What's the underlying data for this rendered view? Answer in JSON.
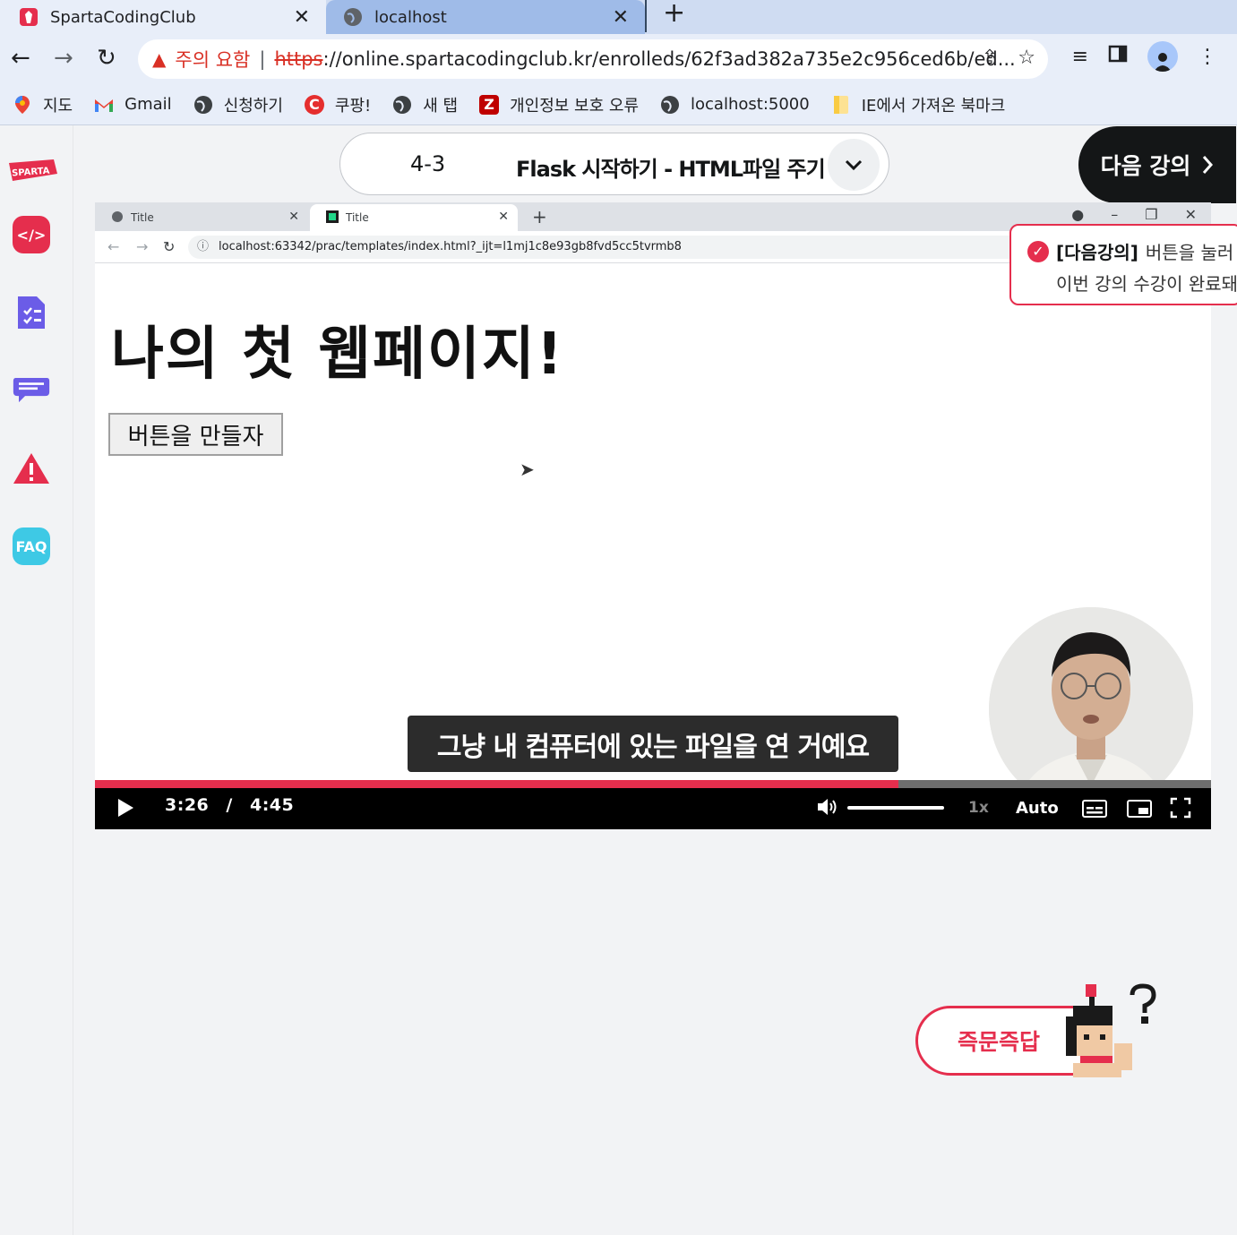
{
  "browser": {
    "tabs": [
      {
        "title": "SpartaCodingClub",
        "active": true
      },
      {
        "title": "localhost",
        "active": false
      }
    ],
    "omnibox": {
      "warning": "주의 요함",
      "scheme": "https",
      "url_rest": "://online.spartacodingclub.kr/enrolleds/62f3ad382a735e2c956ced6b/ed..."
    },
    "bookmarks": [
      {
        "label": "지도",
        "icon": "maps-pin-icon"
      },
      {
        "label": "Gmail",
        "icon": "gmail-icon"
      },
      {
        "label": "신청하기",
        "icon": "globe-icon"
      },
      {
        "label": "쿠팡!",
        "icon": "coupang-icon"
      },
      {
        "label": "새 탭",
        "icon": "globe-icon"
      },
      {
        "label": "개인정보 보호 오류",
        "icon": "filezilla-icon"
      },
      {
        "label": "localhost:5000",
        "icon": "globe-icon"
      },
      {
        "label": "IE에서 가져온 북마크",
        "icon": "folder-icon"
      }
    ]
  },
  "sidebar": {
    "logo": "SPARTA",
    "items": [
      {
        "name": "code-icon"
      },
      {
        "name": "checklist-icon"
      },
      {
        "name": "chat-icon"
      },
      {
        "name": "warning-icon"
      },
      {
        "name": "faq-icon",
        "label": "FAQ"
      }
    ]
  },
  "lecture": {
    "number": "4-3",
    "title": "Flask 시작하기 - HTML파일 주기",
    "next_label": "다음 강의"
  },
  "video": {
    "inner_tabs": [
      "Title",
      "Title"
    ],
    "inner_url": "localhost:63342/prac/templates/index.html?_ijt=l1mj1c8e93gb8fvd5cc5tvrmb8",
    "page_heading": "나의 첫 웹페이지!",
    "page_button": "버튼을 만들자",
    "subtitle": "그냥 내 컴퓨터에 있는 파일을 연 거예요",
    "time_current": "3:26",
    "time_separator": "/",
    "time_total": "4:45",
    "progress": 0.72,
    "speed": "1x",
    "quality": "Auto"
  },
  "toast": {
    "highlight": "[다음강의]",
    "line1_rest": "버튼을 눌러",
    "line2": "이번 강의 수강이 완료돼"
  },
  "qa": {
    "label": "즉문즉답"
  },
  "colors": {
    "brand_red": "#e52e4d",
    "dark": "#141617"
  }
}
